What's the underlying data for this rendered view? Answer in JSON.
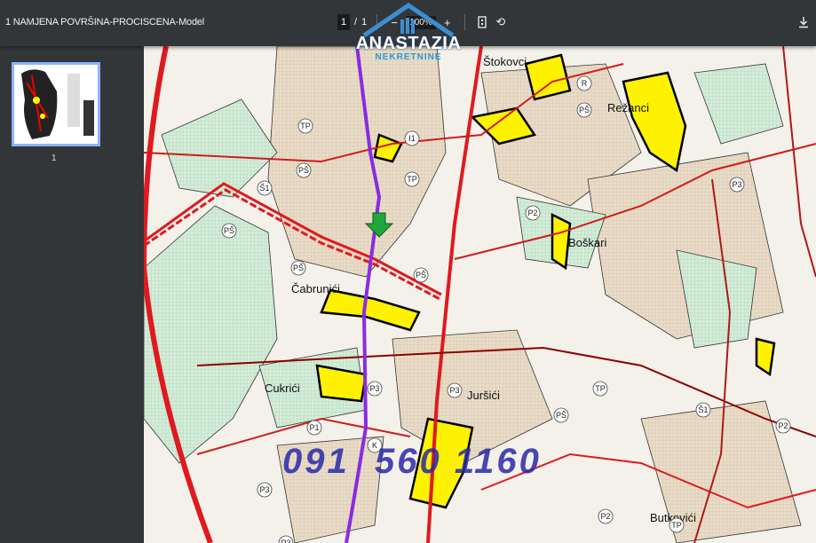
{
  "toolbar": {
    "title": "1 NAMJENA POVRŠINA-PROCISCENA-Model",
    "page_current": "1",
    "page_sep": "/",
    "page_total": "1",
    "zoom_out": "−",
    "zoom": "100%",
    "zoom_in": "+"
  },
  "sidebar": {
    "thumb_number": "1"
  },
  "watermark": {
    "brand": "ANASTAZIA",
    "sub": "NEKRETNINE",
    "phone": "091  560 1160"
  },
  "map": {
    "places": [
      "Štokovci",
      "Režanci",
      "Boškari",
      "Čabrunići",
      "Cukrići",
      "Juršići",
      "Butkovići"
    ],
    "codes": [
      "TP",
      "PŠ",
      "Š1",
      "I1",
      "PŠ",
      "TP",
      "P2",
      "P3",
      "PŠ",
      "P3",
      "P3",
      "TP",
      "P1",
      "K",
      "P2",
      "P3",
      "R",
      "PŠ",
      "PŠ",
      "TP",
      "P2",
      "Š1",
      "PŠ",
      "P3"
    ]
  },
  "colors": {
    "road": "#e0191f",
    "yellow": "#fff200",
    "green": "#cfe9d2",
    "purple": "#8a2be2"
  }
}
